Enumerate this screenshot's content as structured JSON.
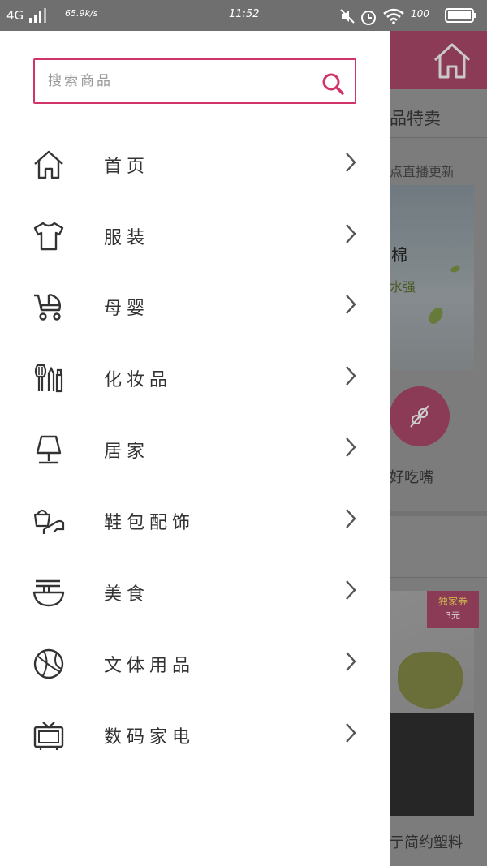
{
  "status_bar": {
    "network": "4G",
    "speed": "65.9k/s",
    "time": "11:52",
    "battery": "100"
  },
  "search": {
    "placeholder": "搜索商品"
  },
  "menu": [
    {
      "label": "首页",
      "icon": "home-icon"
    },
    {
      "label": "服装",
      "icon": "tshirt-icon"
    },
    {
      "label": "母婴",
      "icon": "stroller-icon"
    },
    {
      "label": "化妆品",
      "icon": "makeup-brush-icon"
    },
    {
      "label": "居家",
      "icon": "lamp-icon"
    },
    {
      "label": "鞋包配饰",
      "icon": "bag-shoe-icon"
    },
    {
      "label": "美食",
      "icon": "noodle-bowl-icon"
    },
    {
      "label": "文体用品",
      "icon": "basketball-icon"
    },
    {
      "label": "数码家电",
      "icon": "tv-icon"
    }
  ],
  "background_page": {
    "title_fragment": "品特卖",
    "subtitle_fragment": "点直播更新",
    "banner_text1": "棉",
    "banner_text2": "水强",
    "category_label": "好吃嘴",
    "coupon_title": "独家券",
    "coupon_value": "3元",
    "bottom_text": "亍简约塑料"
  },
  "colors": {
    "accent": "#d0346a",
    "icon": "#333333",
    "chevron": "#555555"
  }
}
